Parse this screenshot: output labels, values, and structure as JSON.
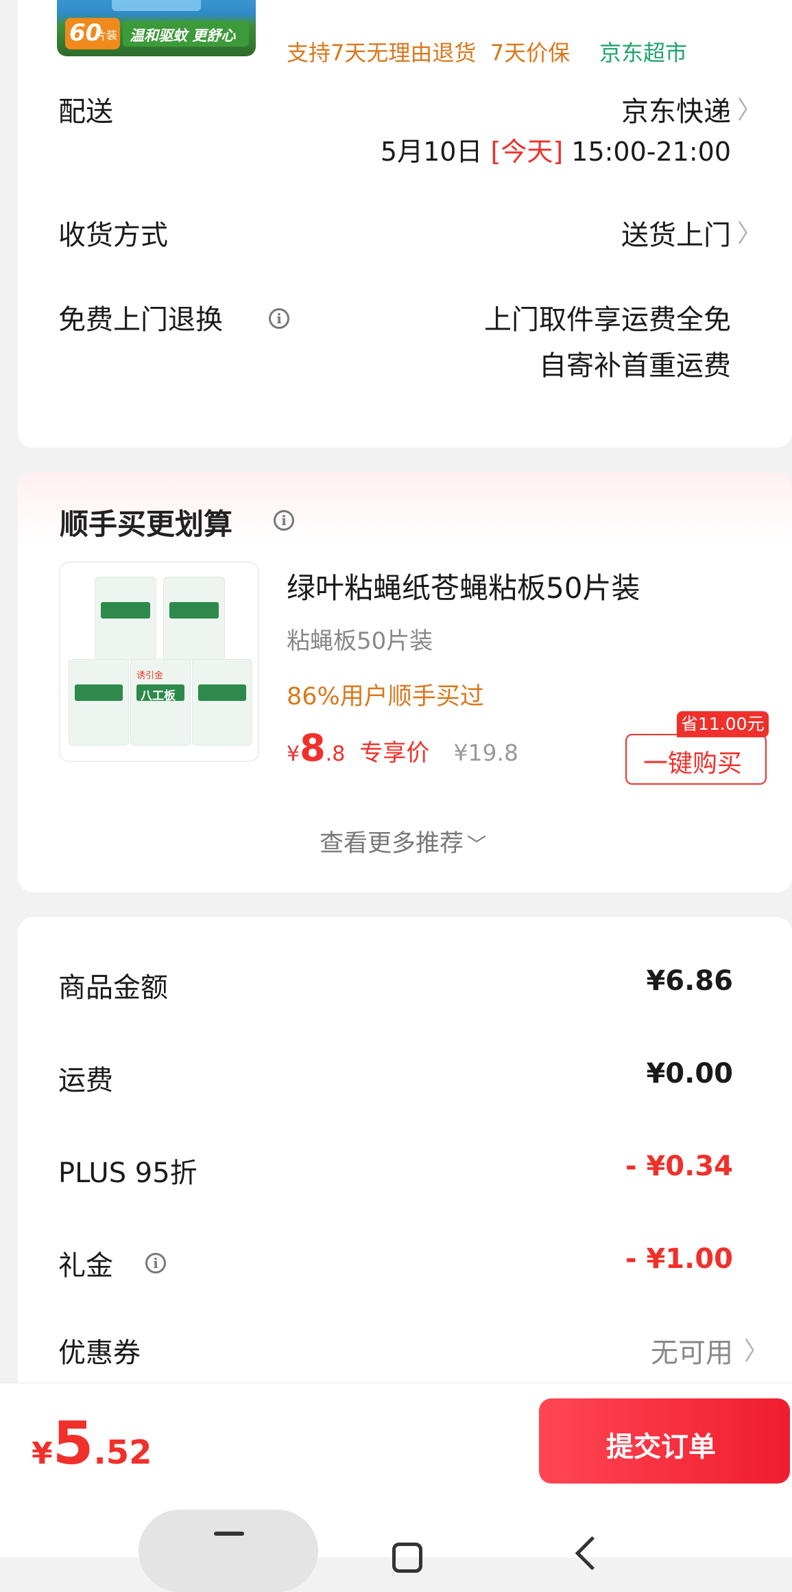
{
  "top_product": {
    "badge_count": "60",
    "badge_unit": "片装",
    "badge_slogan": "温和驱蚊 更舒心",
    "service_tags": "支持7天无理由退货  7天价保",
    "store_tag": "京东超市"
  },
  "delivery": {
    "label": "配送",
    "carrier": "京东快递",
    "date": "5月10日",
    "today_tag": "[今天]",
    "time": "15:00-21:00"
  },
  "receive_method": {
    "label": "收货方式",
    "value": "送货上门"
  },
  "free_return": {
    "label": "免费上门退换",
    "line1": "上门取件享运费全免",
    "line2": "自寄补首重运费"
  },
  "recommend": {
    "title": "顺手买更划算",
    "product_name": "绿叶粘蝇纸苍蝇粘板50片装",
    "spec": "粘蝇板50片装",
    "social_proof": "86%用户顺手买过",
    "currency": "¥",
    "price_int": "8",
    "price_dec": ".8",
    "price_tag": "专享价",
    "original_price": "¥19.8",
    "save_badge": "省11.00元",
    "buy_button": "一键购买",
    "more_link": "查看更多推荐",
    "image_label": "八工板",
    "image_brand": "诱引金"
  },
  "summary": {
    "rows": [
      {
        "label": "商品金额",
        "value": "¥6.86"
      },
      {
        "label": "运费",
        "value": "¥0.00"
      },
      {
        "label": "PLUS 95折",
        "value": "- ¥0.34"
      },
      {
        "label": "礼金",
        "value": "- ¥1.00"
      },
      {
        "label": "优惠券",
        "value": "无可用"
      }
    ]
  },
  "footer": {
    "currency": "¥",
    "total_int": "5",
    "total_dec": ".52",
    "submit_button": "提交订单"
  },
  "colors": {
    "accent_red": "#f0302a",
    "orange": "#d9781c",
    "green": "#1fa56b"
  }
}
